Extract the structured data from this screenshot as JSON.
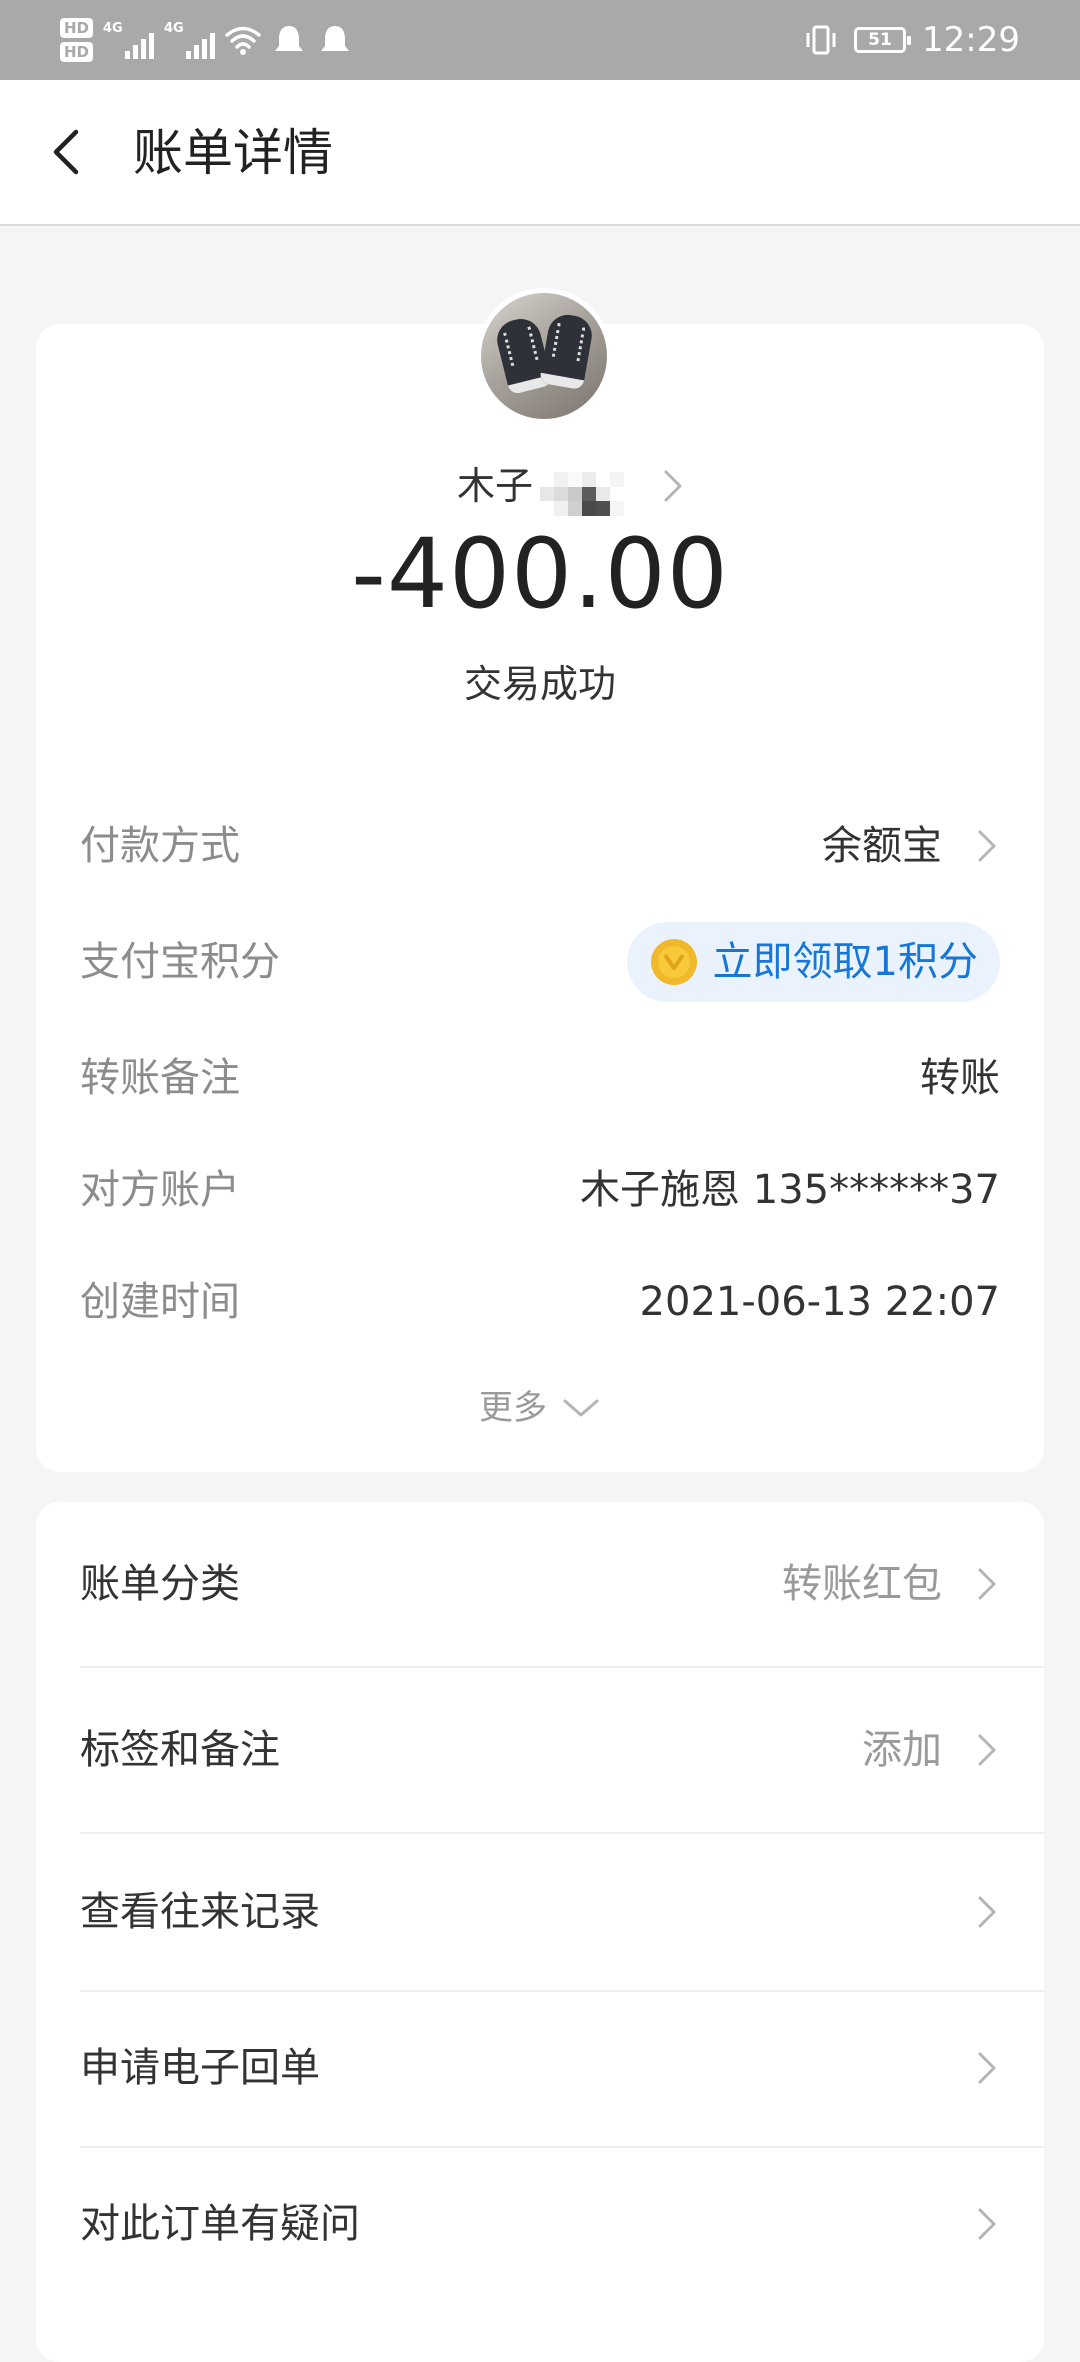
{
  "status_bar": {
    "hd1": "HD",
    "hd2": "HD",
    "net1": "4G",
    "net2": "4G",
    "battery": "51",
    "time": "12:29",
    "icons": [
      "signal-icon",
      "wifi-icon",
      "notification-bell-icon",
      "vibrate-icon",
      "battery-icon"
    ]
  },
  "nav": {
    "title": "账单详情"
  },
  "payee": {
    "name_visible": "木子",
    "amount": "-400.00",
    "status": "交易成功"
  },
  "details": [
    {
      "label": "付款方式",
      "value": "余额宝"
    },
    {
      "label": "支付宝积分",
      "value": "立即领取1积分"
    },
    {
      "label": "转账备注",
      "value": "转账"
    },
    {
      "label": "对方账户",
      "value": "木子施恩 135******37"
    },
    {
      "label": "创建时间",
      "value": "2021-06-13 22:07"
    }
  ],
  "more_label": "更多",
  "actions": [
    {
      "label": "账单分类",
      "value": "转账红包"
    },
    {
      "label": "标签和备注",
      "value": "添加"
    },
    {
      "label": "查看往来记录",
      "value": ""
    },
    {
      "label": "申请电子回单",
      "value": ""
    },
    {
      "label": "对此订单有疑问",
      "value": ""
    }
  ],
  "colors": {
    "status_bar": "#a9a9a9",
    "link_blue": "#1677d8",
    "pill_bg": "#eaf3fd",
    "coin": "#f1b82b",
    "background": "#f5f5f5"
  }
}
